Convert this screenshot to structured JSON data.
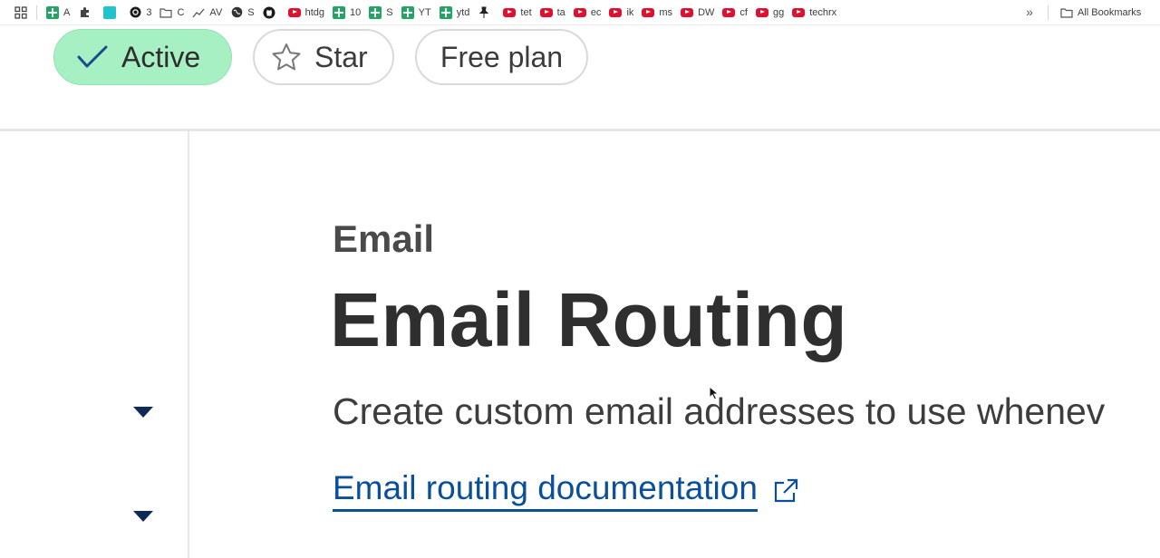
{
  "bookmarks": {
    "items": [
      {
        "label": "A",
        "icon": "sheets-icon"
      },
      {
        "label": "",
        "icon": "puzzle-icon"
      },
      {
        "label": "",
        "icon": "g-icon"
      },
      {
        "label": "3",
        "icon": "threads-icon"
      },
      {
        "label": "C",
        "icon": "folder-icon"
      },
      {
        "label": "AV",
        "icon": "trend-icon"
      },
      {
        "label": "S",
        "icon": "globe-icon"
      },
      {
        "label": "",
        "icon": "github-icon"
      },
      {
        "label": "htdg",
        "icon": "youtube-icon"
      },
      {
        "label": "10",
        "icon": "sheets-icon"
      },
      {
        "label": "S",
        "icon": "sheets-icon"
      },
      {
        "label": "YT",
        "icon": "sheets-icon"
      },
      {
        "label": "ytd",
        "icon": "sheets-icon"
      },
      {
        "label": "",
        "icon": "pin-icon"
      },
      {
        "label": "tet",
        "icon": "youtube-icon"
      },
      {
        "label": "ta",
        "icon": "youtube-icon"
      },
      {
        "label": "ec",
        "icon": "youtube-icon"
      },
      {
        "label": "ik",
        "icon": "youtube-icon"
      },
      {
        "label": "ms",
        "icon": "youtube-icon"
      },
      {
        "label": "DW",
        "icon": "youtube-icon"
      },
      {
        "label": "cf",
        "icon": "youtube-icon"
      },
      {
        "label": "gg",
        "icon": "youtube-icon"
      },
      {
        "label": "techrx",
        "icon": "youtube-icon"
      }
    ],
    "more": "»",
    "all_bookmarks": "All Bookmarks"
  },
  "header": {
    "active_label": "Active",
    "star_label": "Star",
    "plan_label": "Free plan"
  },
  "main": {
    "eyebrow": "Email",
    "title": "Email Routing",
    "description": "Create custom email addresses to use whenev",
    "doc_link": "Email routing documentation"
  },
  "colors": {
    "active_pill": "#a7f0c4",
    "link": "#0a4f9c",
    "caret": "#0f2a55"
  }
}
